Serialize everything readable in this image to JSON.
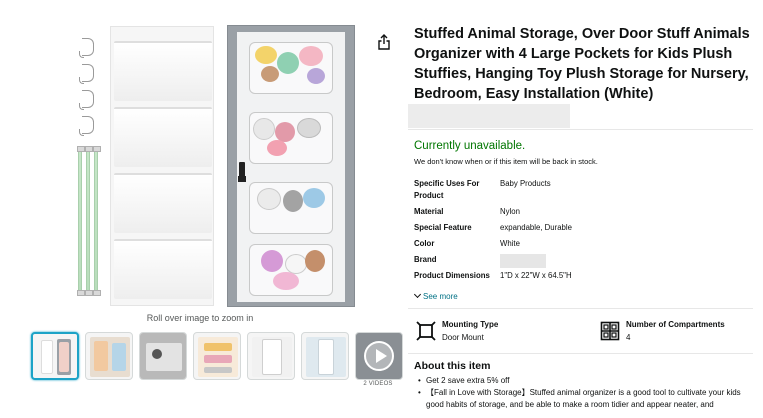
{
  "product": {
    "title": "Stuffed Animal Storage, Over Door Stuff Animals Organizer with 4 Large Pockets for Kids Plush Stuffies, Hanging Toy Plush Storage for Nursery, Bedroom, Easy Installation (White)",
    "availability": "Currently unavailable.",
    "availability_note": "We don't know when or if this item will be back in stock."
  },
  "gallery": {
    "zoom_hint": "Roll over image to zoom in",
    "videos_label": "2 VIDEOS",
    "icons": {
      "share": "share-icon",
      "play": "play-icon"
    }
  },
  "specs": [
    {
      "key": "Specific Uses For Product",
      "value": "Baby Products"
    },
    {
      "key": "Material",
      "value": "Nylon"
    },
    {
      "key": "Special Feature",
      "value": "expandable, Durable"
    },
    {
      "key": "Color",
      "value": "White"
    },
    {
      "key": "Brand",
      "value": ""
    },
    {
      "key": "Product Dimensions",
      "value": "1\"D x 22\"W x 64.5\"H"
    }
  ],
  "see_more": "See more",
  "features": [
    {
      "label": "Mounting Type",
      "value": "Door Mount",
      "icon": "mount-icon"
    },
    {
      "label": "Number of Compartments",
      "value": "4",
      "icon": "compartments-icon"
    }
  ],
  "about": {
    "heading": "About this item",
    "bullets": [
      "Get 2 save extra 5% off",
      "【Fall in Love with Storage】Stuffed animal organizer is a good tool to cultivate your kids good habits of storage, and be able to make a room tidier and appear neater, and"
    ]
  },
  "colors": {
    "availability_green": "#007600",
    "link_teal": "#007185",
    "thumb_selected": "#1ca3c7"
  }
}
